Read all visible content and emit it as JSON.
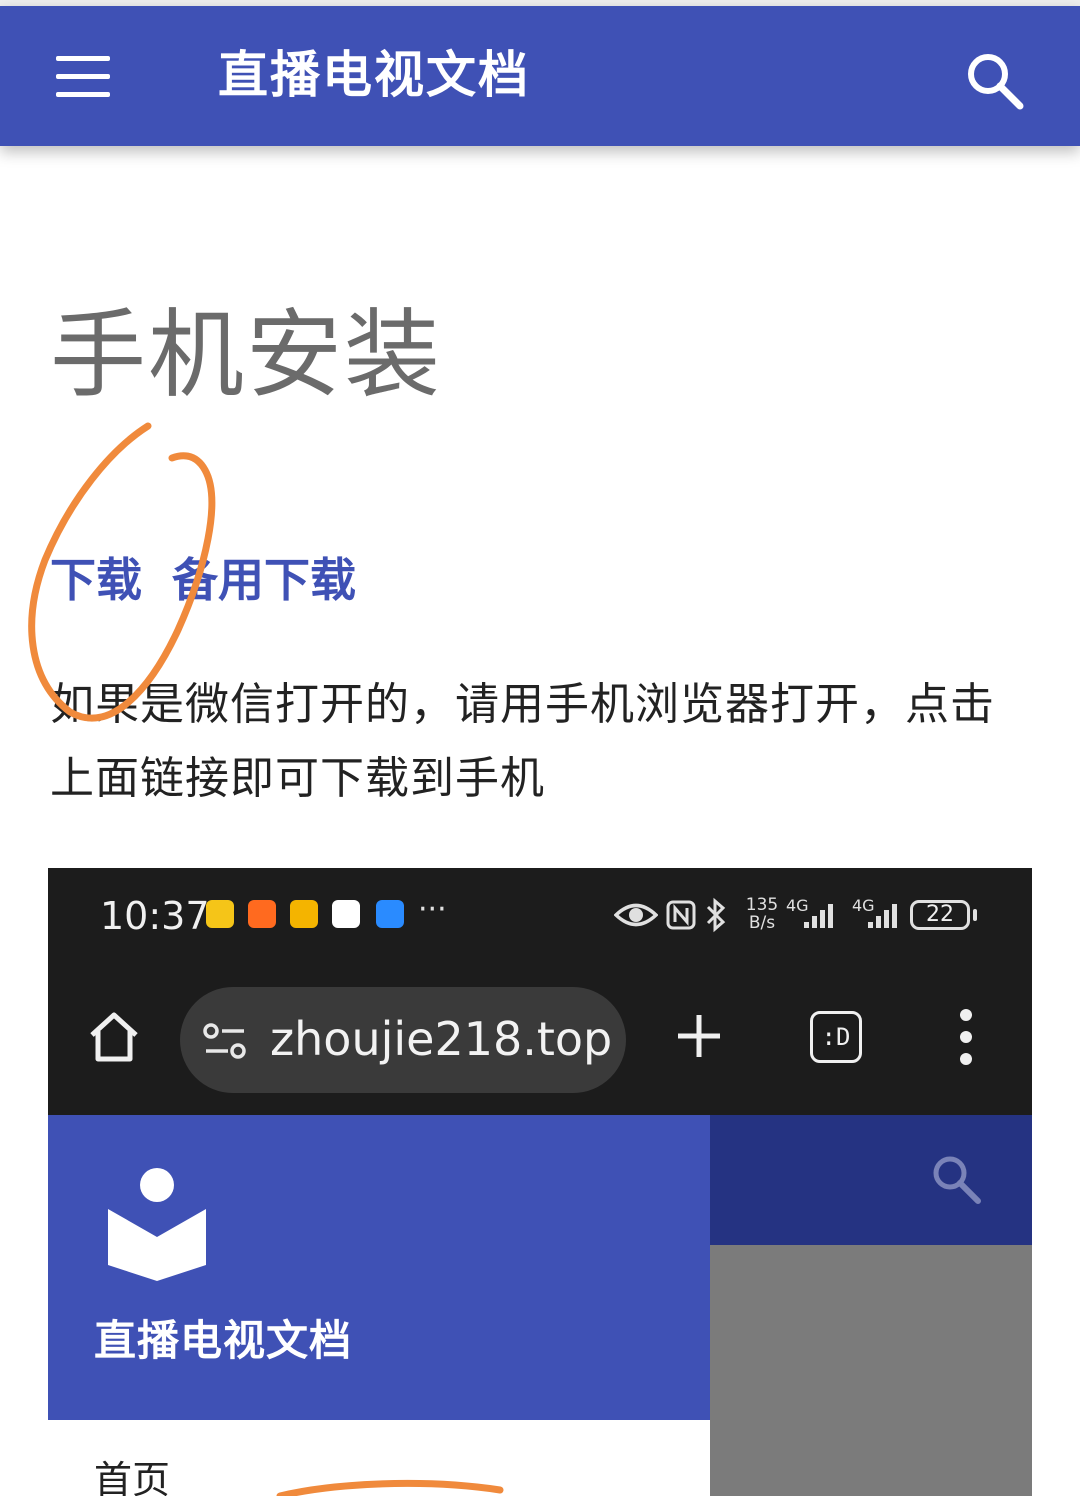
{
  "appbar": {
    "title": "直播电视文档"
  },
  "content": {
    "page_title": "手机安装",
    "links": [
      "下载",
      "备用下载"
    ],
    "paragraph": "如果是微信打开的，请用手机浏览器打开，点击上面链接即可下载到手机"
  },
  "embedded_screenshot": {
    "status_bar": {
      "time": "10:37",
      "notification_icons": [
        "meituan-hotel-icon",
        "taobao-icon",
        "mail-icon",
        "qq-icon",
        "app-icon"
      ],
      "overflow": "···",
      "network_speed_value": "135",
      "network_speed_unit": "B/s",
      "network_type_1": "4G",
      "network_type_2": "4G",
      "battery": "22"
    },
    "browser": {
      "url": "zhoujie218.top",
      "tabs_label": ":D"
    },
    "drawer": {
      "title": "直播电视文档",
      "items": [
        "首页"
      ]
    }
  },
  "colors": {
    "primary": "#3f51b5",
    "primary_dark": "#253382",
    "link": "#3f51b5",
    "annotation": "#f08a3c"
  }
}
